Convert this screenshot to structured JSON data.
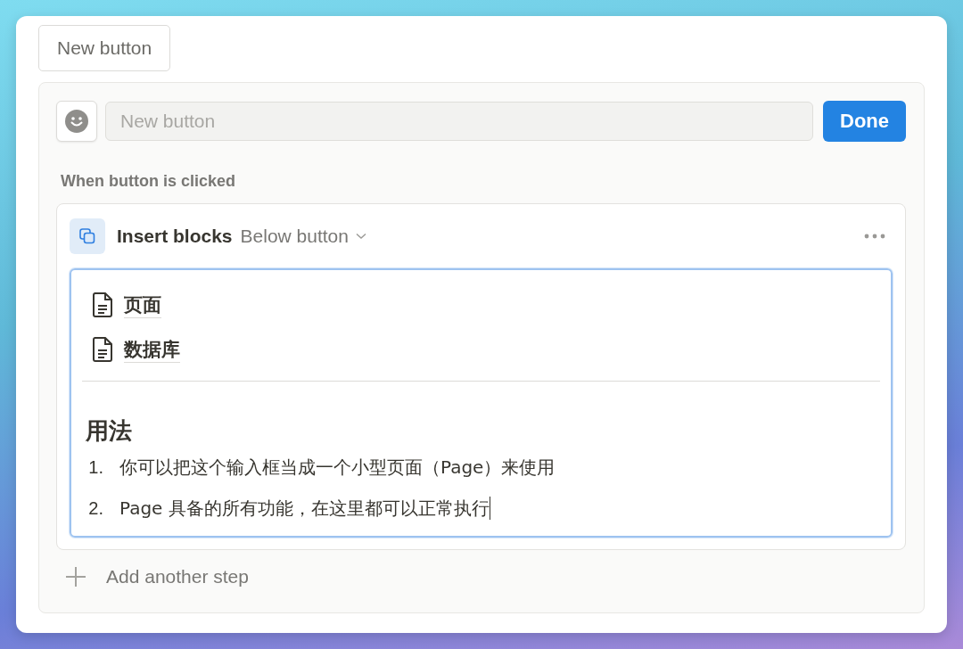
{
  "top_button": {
    "label": "New button"
  },
  "editor": {
    "name_field": {
      "placeholder": "New button"
    },
    "done_button": "Done",
    "trigger_label": "When button is clicked",
    "step": {
      "action": "Insert blocks",
      "position": "Below button",
      "content": {
        "pages": [
          {
            "title": "页面"
          },
          {
            "title": "数据库"
          }
        ],
        "heading": "用法",
        "list": [
          {
            "number": "1.",
            "text": "你可以把这个输入框当成一个小型页面（Page）来使用"
          },
          {
            "number": "2.",
            "text": "Page 具备的所有功能，在这里都可以正常执行"
          }
        ]
      }
    },
    "add_step": "Add another step"
  }
}
